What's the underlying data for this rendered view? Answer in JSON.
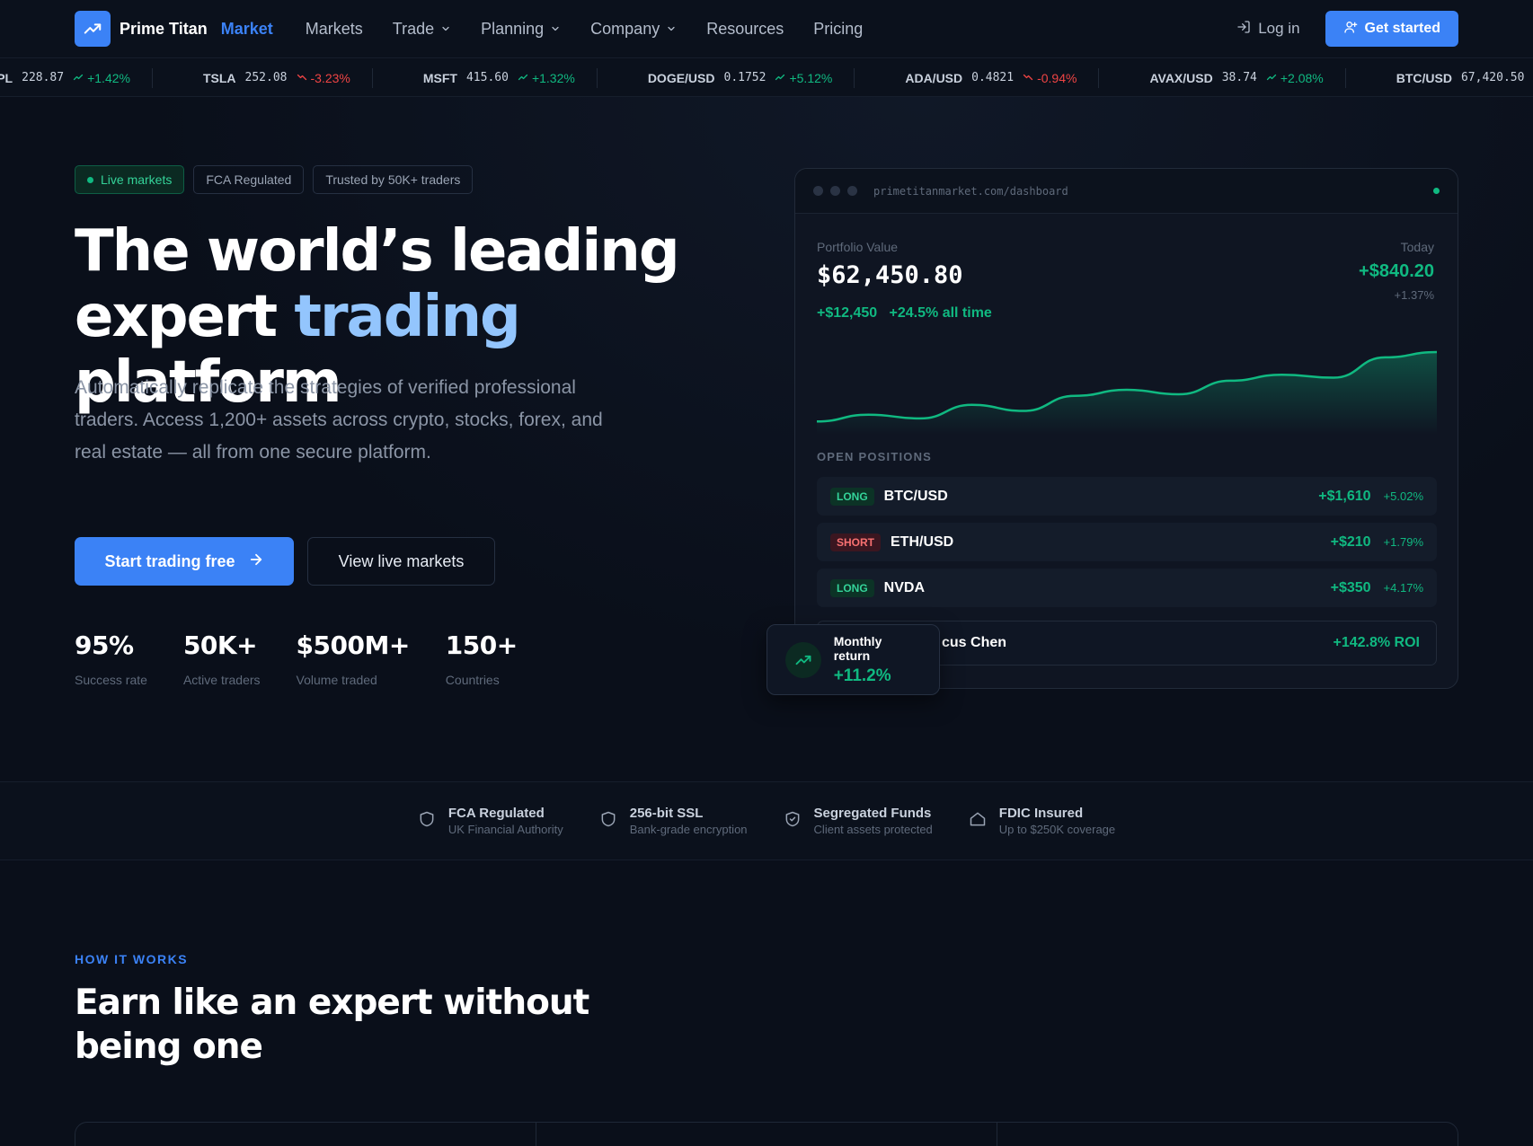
{
  "brand": {
    "name": "Prime Titan",
    "accent": "Market",
    "color": "#3b82f6"
  },
  "nav": {
    "links": [
      {
        "label": "Markets",
        "dropdown": false
      },
      {
        "label": "Trade",
        "dropdown": true
      },
      {
        "label": "Planning",
        "dropdown": true
      },
      {
        "label": "Company",
        "dropdown": true
      },
      {
        "label": "Resources",
        "dropdown": false
      },
      {
        "label": "Pricing",
        "dropdown": false
      }
    ],
    "login": "Log in",
    "cta": "Get started"
  },
  "ticker": [
    {
      "symbol": "AAPL",
      "price": "228.87",
      "change": "+1.42%",
      "dir": "up"
    },
    {
      "symbol": "TSLA",
      "price": "252.08",
      "change": "-3.23%",
      "dir": "down"
    },
    {
      "symbol": "MSFT",
      "price": "415.60",
      "change": "+1.32%",
      "dir": "up"
    },
    {
      "symbol": "DOGE/USD",
      "price": "0.1752",
      "change": "+5.12%",
      "dir": "up"
    },
    {
      "symbol": "ADA/USD",
      "price": "0.4821",
      "change": "-0.94%",
      "dir": "down"
    },
    {
      "symbol": "AVAX/USD",
      "price": "38.74",
      "change": "+2.08%",
      "dir": "up"
    },
    {
      "symbol": "BTC/USD",
      "price": "67,420.50",
      "change": "",
      "dir": "up"
    }
  ],
  "hero": {
    "badges": [
      "Live markets",
      "FCA Regulated",
      "Trusted by 50K+ traders"
    ],
    "headline_line1": "The world’s leading",
    "headline_line2_a": "expert",
    "headline_line2_b": "trading",
    "headline_line2_c": "platform",
    "lede": "Automatically replicate the strategies of verified professional traders. Access 1,200+ assets across crypto, stocks, forex, and real estate — all from one secure platform.",
    "primary_cta": "Start trading free",
    "secondary_cta": "View live markets",
    "stats": [
      {
        "value": "95%",
        "label": "Success rate"
      },
      {
        "value": "50K+",
        "label": "Active traders"
      },
      {
        "value": "$500M+",
        "label": "Volume traded"
      },
      {
        "value": "150+",
        "label": "Countries"
      }
    ]
  },
  "dashboard": {
    "url": "primetitanmarket.com/dashboard",
    "portfolio_label": "Portfolio Value",
    "portfolio_value": "$62,450.80",
    "gain_abs": "+$12,450",
    "gain_pct": "+24.5% all time",
    "today_label": "Today",
    "today_value": "+$840.20",
    "today_pct": "+1.37%",
    "open_positions_label": "OPEN POSITIONS",
    "positions": [
      {
        "side": "LONG",
        "symbol": "BTC/USD",
        "pnl": "+$1,610",
        "pct": "+5.02%"
      },
      {
        "side": "SHORT",
        "symbol": "ETH/USD",
        "pnl": "+$210",
        "pct": "+1.79%"
      },
      {
        "side": "LONG",
        "symbol": "NVDA",
        "pnl": "+$350",
        "pct": "+4.17%"
      }
    ],
    "trader_name_visible": "cus Chen",
    "trader_roi": "+142.8% ROI",
    "chart_series": [
      0.08,
      0.17,
      0.12,
      0.3,
      0.22,
      0.42,
      0.5,
      0.44,
      0.62,
      0.7,
      0.66,
      0.93,
      1.0
    ],
    "chart_color": "#10b981"
  },
  "floating": {
    "label": "Monthly return",
    "value": "+11.2%"
  },
  "trust": [
    {
      "title": "FCA Regulated",
      "sub": "UK Financial Authority",
      "icon": "shield-icon"
    },
    {
      "title": "256-bit SSL",
      "sub": "Bank-grade encryption",
      "icon": "shield-icon"
    },
    {
      "title": "Segregated Funds",
      "sub": "Client assets protected",
      "icon": "shield-check-icon"
    },
    {
      "title": "FDIC Insured",
      "sub": "Up to $250K coverage",
      "icon": "home-icon"
    }
  ],
  "how": {
    "eyebrow": "HOW IT WORKS",
    "title": "Earn like an expert without being one"
  },
  "colors": {
    "up": "#10b981",
    "down": "#ef4444",
    "accent": "#3b82f6"
  }
}
